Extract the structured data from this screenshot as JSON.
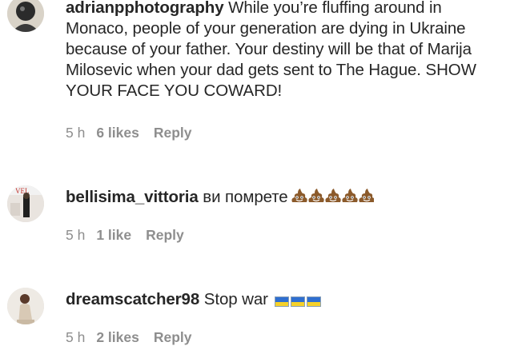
{
  "comments": [
    {
      "username": "adrianpphotography",
      "text": "While you’re fluffing around in Monaco, people of your generation are dying in Ukraine because of your father. Your destiny will be that of Marija Milosevic when your dad gets sent to The Hague. SHOW YOUR FACE YOU COWARD!",
      "time": "5 h",
      "likes": "6 likes",
      "reply": "Reply",
      "avatar_icon": "profile-photo-dark"
    },
    {
      "username": "bellisima_vittoria",
      "text": "ви помрете",
      "emoji": [
        "poop-emoji",
        "poop-emoji",
        "poop-emoji",
        "poop-emoji",
        "poop-emoji"
      ],
      "time": "5 h",
      "likes": "1 like",
      "reply": "Reply",
      "avatar_icon": "profile-photo-woman"
    },
    {
      "username": "dreamscatcher98",
      "text": "Stop war",
      "emoji": [
        "ukraine-flag",
        "ukraine-flag",
        "ukraine-flag"
      ],
      "time": "5 h",
      "likes": "2 likes",
      "reply": "Reply",
      "avatar_icon": "profile-photo-woman-light"
    }
  ],
  "colors": {
    "text": "#262626",
    "meta": "#8e8e8e",
    "flag_blue": "#2f6fd0",
    "flag_yellow": "#f5d12a"
  }
}
